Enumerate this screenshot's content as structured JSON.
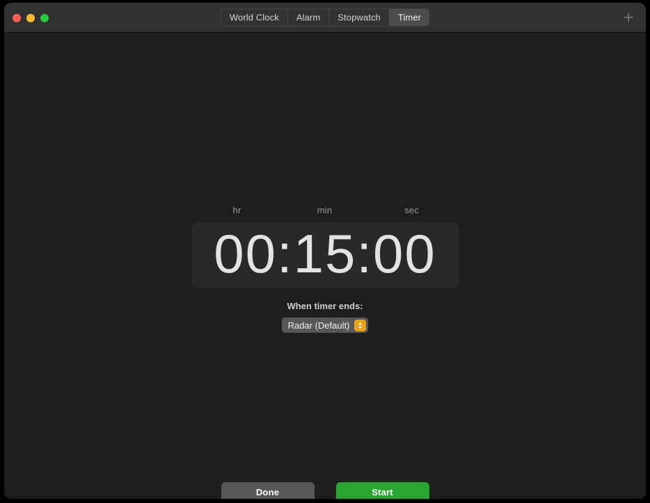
{
  "window": {
    "traffic_lights": [
      {
        "name": "close",
        "color": "#ff5f57"
      },
      {
        "name": "minimize",
        "color": "#febc2e"
      },
      {
        "name": "maximize",
        "color": "#28c840"
      }
    ]
  },
  "toolbar": {
    "tabs": [
      {
        "label": "World Clock",
        "selected": false
      },
      {
        "label": "Alarm",
        "selected": false
      },
      {
        "label": "Stopwatch",
        "selected": false
      },
      {
        "label": "Timer",
        "selected": true
      }
    ],
    "add_icon": "plus-icon"
  },
  "timer": {
    "unit_labels": {
      "hours": "hr",
      "minutes": "min",
      "seconds": "sec"
    },
    "display": "00:15:00",
    "hours": "00",
    "minutes": "15",
    "seconds": "00",
    "separator": ":"
  },
  "sound": {
    "label": "When timer ends:",
    "selected": "Radar (Default)",
    "stepper_icon": "chevron-up-down-icon",
    "accent_color": "#e8a21c"
  },
  "actions": {
    "done_label": "Done",
    "start_label": "Start",
    "start_color": "#29a532"
  }
}
